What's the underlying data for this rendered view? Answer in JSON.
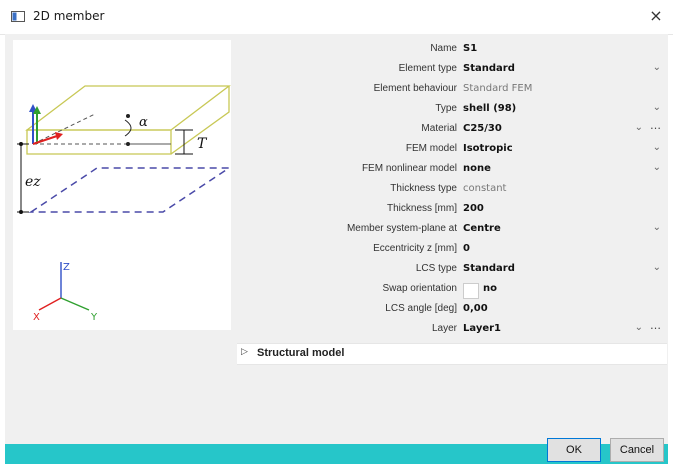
{
  "window": {
    "title": "2D member",
    "close_glyph": "×"
  },
  "diagram": {
    "alpha": "α",
    "t": "T",
    "ez": "ez",
    "axis_z": "Z",
    "axis_x": "X",
    "axis_y": "Y",
    "colors": {
      "slab": "#c8c855",
      "plane": "#4a4aa8",
      "red": "#e02020",
      "green": "#30a030",
      "blue": "#3050c8"
    }
  },
  "properties": [
    {
      "label": "Name",
      "value": "S1",
      "control": "text"
    },
    {
      "label": "Element type",
      "value": "Standard",
      "control": "dropdown"
    },
    {
      "label": "Element behaviour",
      "value": "Standard FEM",
      "control": "readonly"
    },
    {
      "label": "Type",
      "value": "shell (98)",
      "control": "dropdown"
    },
    {
      "label": "Material",
      "value": "C25/30",
      "control": "dropdown-more"
    },
    {
      "label": "FEM model",
      "value": "Isotropic",
      "control": "dropdown"
    },
    {
      "label": "FEM nonlinear model",
      "value": "none",
      "control": "dropdown"
    },
    {
      "label": "Thickness type",
      "value": "constant",
      "control": "readonly"
    },
    {
      "label": "Thickness [mm]",
      "value": "200",
      "control": "text"
    },
    {
      "label": "Member system-plane at",
      "value": "Centre",
      "control": "dropdown"
    },
    {
      "label": "Eccentricity z [mm]",
      "value": "0",
      "control": "text"
    },
    {
      "label": "LCS type",
      "value": "Standard",
      "control": "dropdown"
    },
    {
      "label": "Swap orientation",
      "value": "no",
      "control": "checkbox"
    },
    {
      "label": "LCS angle [deg]",
      "value": "0,00",
      "control": "text"
    },
    {
      "label": "Layer",
      "value": "Layer1",
      "control": "dropdown-more"
    }
  ],
  "glyphs": {
    "chevron": "⌄",
    "more": "…",
    "expand": "▷"
  },
  "section": {
    "label": "Structural model"
  },
  "buttons": {
    "ok": "OK",
    "cancel": "Cancel"
  }
}
